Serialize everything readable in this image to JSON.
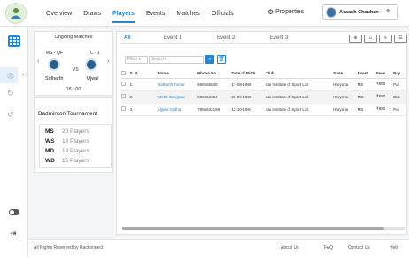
{
  "nav": {
    "items": [
      "Overview",
      "Draws",
      "Players",
      "Events",
      "Matches",
      "Officials"
    ],
    "active_index": 2,
    "properties_label": "Properties",
    "user_name": "Akaash Chauhan"
  },
  "ongoing": {
    "title": "Ongoing Matches",
    "match_left": "MS - QF",
    "match_right": "C - 1",
    "player_left": "Sidharth",
    "player_right": "Ujwal",
    "vs": "VS",
    "time": "18 : 00"
  },
  "tournament": {
    "title": "Badminton Tournament",
    "events": [
      {
        "code": "MS",
        "count": "20 Players"
      },
      {
        "code": "WS",
        "count": "14 Players"
      },
      {
        "code": "MD",
        "count": "18 Players"
      },
      {
        "code": "WD",
        "count": "16 Players"
      }
    ]
  },
  "tabs": [
    "All",
    "Event 1",
    "Event 2",
    "Event 3"
  ],
  "filter": {
    "label": "Filter",
    "search_placeholder": "Search"
  },
  "table": {
    "headers": [
      "S. N.",
      "Name",
      "Phone No.",
      "Date of Birth",
      "Club",
      "State",
      "Event",
      "Fees",
      "Pay"
    ],
    "rows": [
      [
        "1.",
        "Sidharth Tomar",
        "988556845",
        "17-08-1996",
        "Sai Institute of Sport Ltd.",
        "Haryana",
        "MS",
        "₹800",
        "Pai"
      ],
      [
        "2.",
        "Mohit Gangwar",
        "896652354",
        "26-09-1996",
        "Sai Institute of Sport Ltd.",
        "Haryana",
        "MS",
        "₹800",
        "Due"
      ],
      [
        "3.",
        "Ujjwal Sjidha",
        "7856632159",
        "12-10-1994",
        "Sai Institute of Sport Ltd.",
        "Haryana",
        "MS",
        "₹800",
        "Pai"
      ]
    ]
  },
  "footer": {
    "rights": "All Rights Reserved by Rackonnect",
    "links": [
      "About Us",
      "FAQ",
      "Contact Us",
      "Help"
    ]
  },
  "colors": {
    "accent": "#2a84c9"
  }
}
